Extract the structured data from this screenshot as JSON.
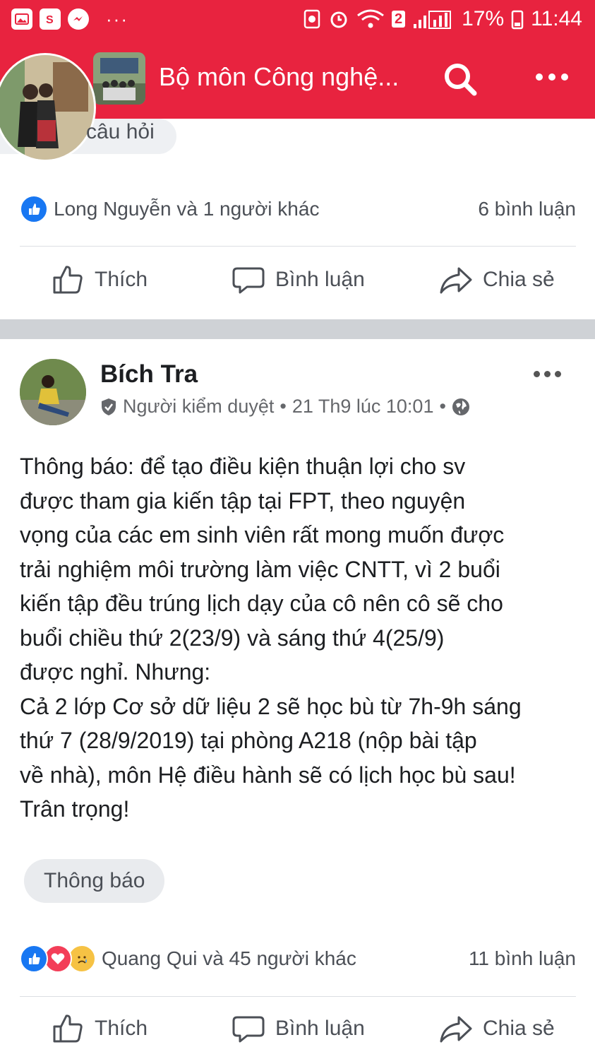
{
  "status_bar": {
    "badge": "2",
    "battery": "17%",
    "time": "11:44"
  },
  "header": {
    "title": "Bộ môn Công nghệ..."
  },
  "previous_post": {
    "tag_label": "câu hỏi",
    "reactions_text": "Long Nguyễn và 1 người khác",
    "comments_text": "6 bình luận"
  },
  "actions": {
    "like": "Thích",
    "comment": "Bình luận",
    "share": "Chia sẻ"
  },
  "post": {
    "author": "Bích Tra",
    "role": "Người kiểm duyệt",
    "timestamp": "21 Th9 lúc 10:01",
    "body_lines": [
      "Thông báo: để tạo điều kiện thuận lợi cho sv",
      "được tham gia kiến tập tại FPT, theo nguyện",
      "vọng của các em sinh viên rất mong muốn được",
      "trải nghiệm môi trường làm việc CNTT, vì 2 buổi",
      "kiến tập đều trúng lịch dạy của cô nên cô sẽ cho",
      "buổi chiều thứ 2(23/9) và sáng thứ 4(25/9)",
      "được nghỉ. Nhưng:",
      "Cả 2 lớp Cơ sở dữ liệu 2 sẽ học bù từ 7h-9h sáng",
      "thứ 7 (28/9/2019) tại phòng A218 (nộp bài tập",
      "về nhà), môn Hệ điều hành sẽ có lịch học bù sau!",
      "Trân trọng!"
    ],
    "topic": "Thông báo",
    "reactions_text": "Quang Qui và 45 người khác",
    "comments_text": "11 bình luận"
  },
  "colors": {
    "brand_red": "#e8233f",
    "like_blue": "#1877f2",
    "love_red": "#f33e58",
    "text_gray": "#65676b"
  }
}
